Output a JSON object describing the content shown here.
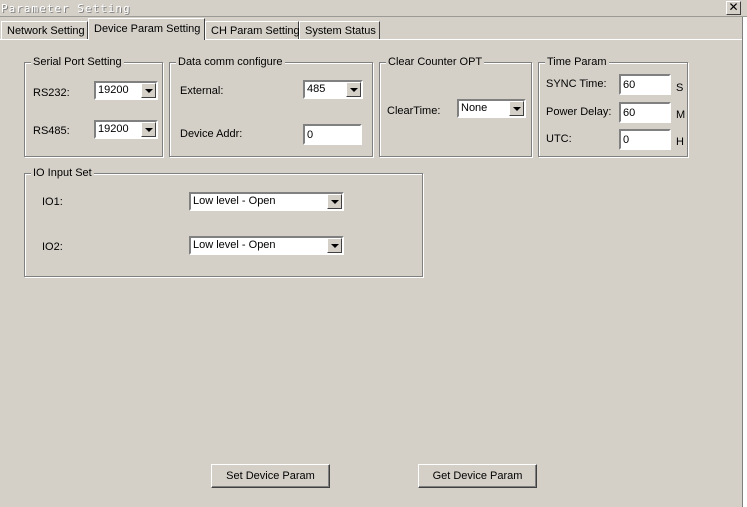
{
  "window": {
    "title": "Parameter Setting",
    "close_glyph": "✕"
  },
  "tabs": [
    {
      "label": "Network Setting"
    },
    {
      "label": "Device Param Setting",
      "active": true
    },
    {
      "label": "CH Param Setting"
    },
    {
      "label": "System Status"
    }
  ],
  "serial_port": {
    "title": "Serial Port Setting",
    "rs232_label": "RS232:",
    "rs232_value": "19200",
    "rs485_label": "RS485:",
    "rs485_value": "19200"
  },
  "data_comm": {
    "title": "Data comm configure",
    "external_label": "External:",
    "external_value": "485",
    "device_addr_label": "Device Addr:",
    "device_addr_value": "0"
  },
  "clear_counter": {
    "title": "Clear Counter OPT",
    "clear_time_label": "ClearTime:",
    "clear_time_value": "None"
  },
  "time_param": {
    "title": "Time Param",
    "sync_label": "SYNC Time:",
    "sync_value": "60",
    "sync_unit": "S",
    "power_label": "Power Delay:",
    "power_value": "60",
    "power_unit": "M",
    "utc_label": "UTC:",
    "utc_value": "0",
    "utc_unit": "H"
  },
  "io_input": {
    "title": "IO Input Set",
    "io1_label": "IO1:",
    "io1_value": "Low level - Open",
    "io2_label": "IO2:",
    "io2_value": "Low level - Open"
  },
  "buttons": {
    "set_label": "Set Device Param",
    "get_label": "Get Device Param"
  }
}
